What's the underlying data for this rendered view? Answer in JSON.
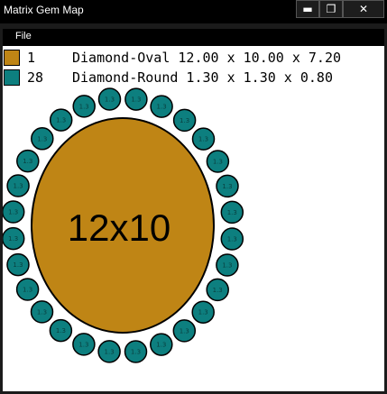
{
  "window": {
    "title": "Matrix Gem Map",
    "minimize_label": "▬",
    "maximize_label": "❐",
    "close_label": "✕"
  },
  "menu": {
    "file_label": "File"
  },
  "legend": [
    {
      "count": "1",
      "description": "Diamond-Oval 12.00 x 10.00 x 7.20",
      "color": "#bf8515"
    },
    {
      "count": "28",
      "description": "Diamond-Round 1.30 x 1.30 x 0.80",
      "color": "#0d7f7f"
    }
  ],
  "gem_map": {
    "center_stone": {
      "label": "12x10",
      "color": "#bf8515"
    },
    "halo": {
      "stone_count": 28,
      "stone_label": "1.3",
      "color": "#0d7f7f"
    }
  }
}
